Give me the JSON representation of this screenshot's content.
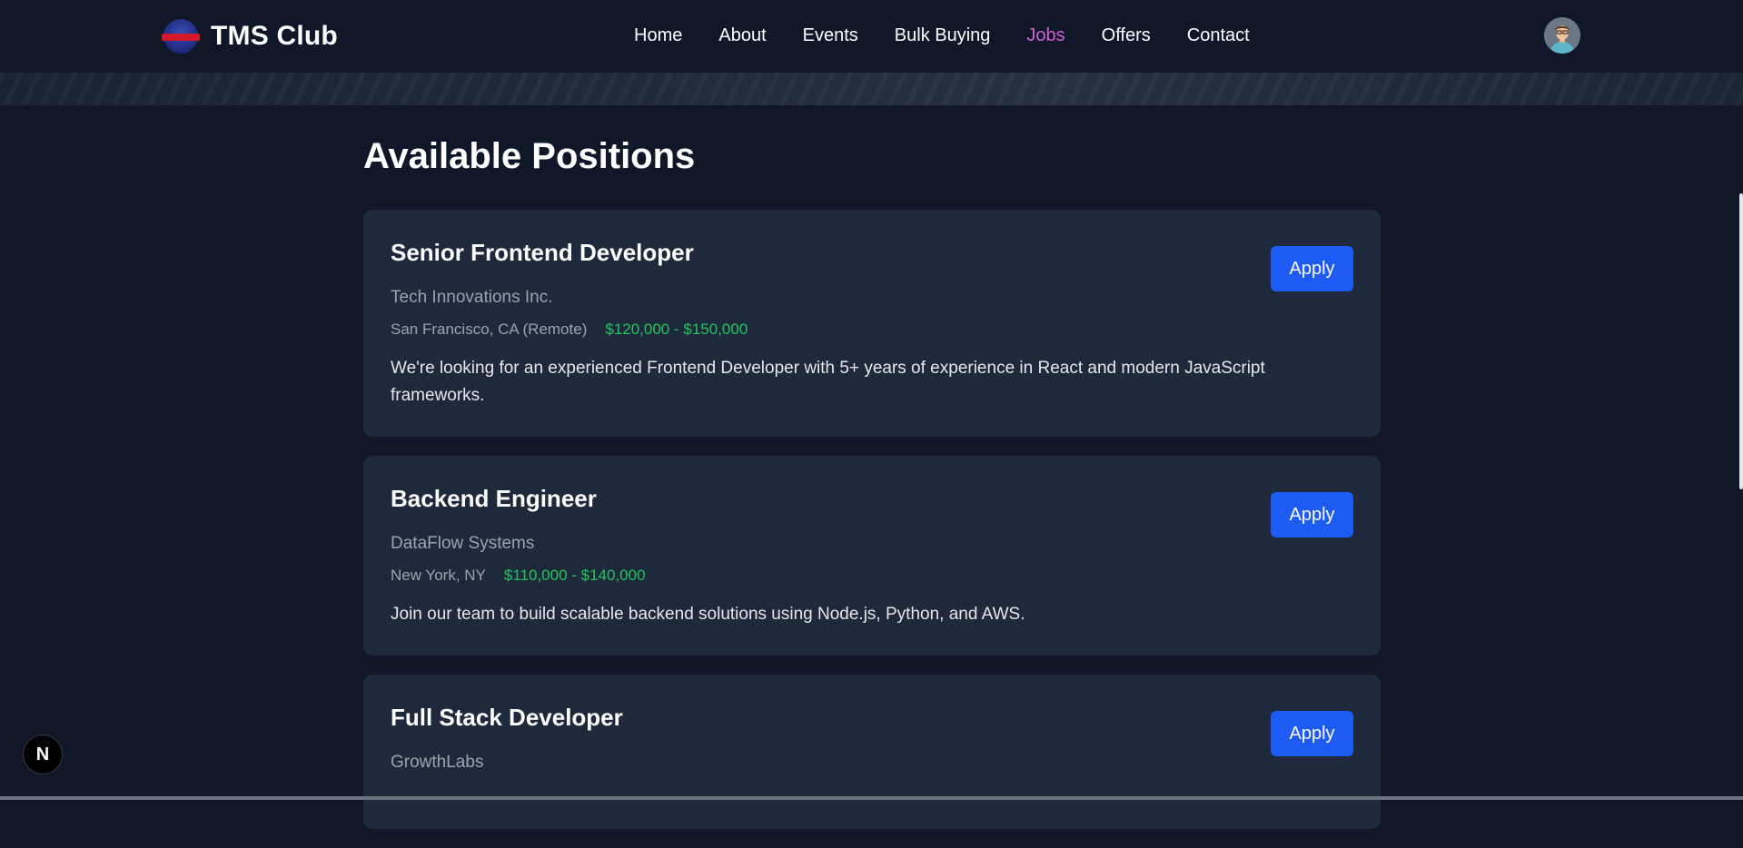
{
  "header": {
    "brand": "TMS Club",
    "nav": [
      {
        "label": "Home",
        "active": false
      },
      {
        "label": "About",
        "active": false
      },
      {
        "label": "Events",
        "active": false
      },
      {
        "label": "Bulk Buying",
        "active": false
      },
      {
        "label": "Jobs",
        "active": true
      },
      {
        "label": "Offers",
        "active": false
      },
      {
        "label": "Contact",
        "active": false
      }
    ],
    "active_color": "#d45ed8"
  },
  "main": {
    "title": "Available Positions",
    "jobs": [
      {
        "title": "Senior Frontend Developer",
        "company": "Tech Innovations Inc.",
        "location": "San Francisco, CA (Remote)",
        "salary": "$120,000 - $150,000",
        "description": "We're looking for an experienced Frontend Developer with 5+ years of experience in React and modern JavaScript frameworks.",
        "apply_label": "Apply"
      },
      {
        "title": "Backend Engineer",
        "company": "DataFlow Systems",
        "location": "New York, NY",
        "salary": "$110,000 - $140,000",
        "description": "Join our team to build scalable backend solutions using Node.js, Python, and AWS.",
        "apply_label": "Apply"
      },
      {
        "title": "Full Stack Developer",
        "company": "GrowthLabs",
        "location": "",
        "salary": "",
        "description": "",
        "apply_label": "Apply"
      }
    ]
  },
  "dev_badge": {
    "label": "N"
  },
  "colors": {
    "background": "#0f1729",
    "card": "#1e293b",
    "salary": "#22c55e",
    "button": "#1d5bf2"
  },
  "icons": {
    "logo": "club-logo-icon",
    "avatar": "user-avatar-icon",
    "dev_badge": "nextjs-icon"
  }
}
